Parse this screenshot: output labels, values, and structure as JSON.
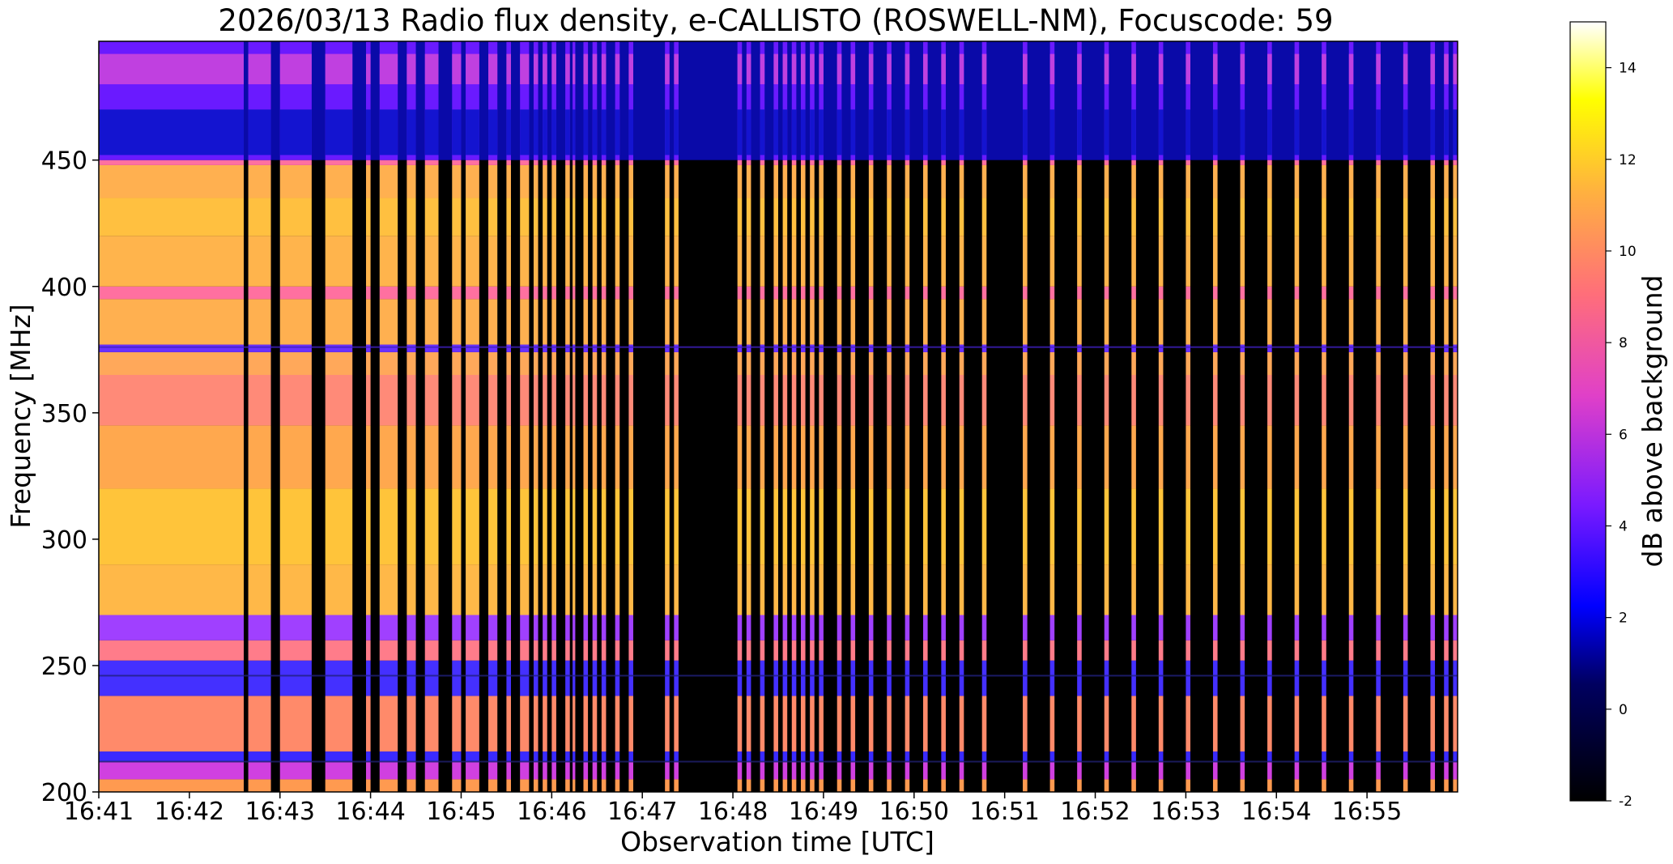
{
  "chart_data": {
    "type": "heatmap",
    "title": "2026/03/13  Radio flux density, e-CALLISTO (ROSWELL-NM), Focuscode: 59",
    "xlabel": "Observation time [UTC]",
    "ylabel": "Frequency [MHz]",
    "colorbar_label": "dB above background",
    "colormap": "gnuplot2",
    "x_ticks": [
      "16:41",
      "16:42",
      "16:43",
      "16:44",
      "16:45",
      "16:46",
      "16:47",
      "16:48",
      "16:49",
      "16:50",
      "16:51",
      "16:52",
      "16:53",
      "16:54",
      "16:55"
    ],
    "xlim": [
      "16:41:00",
      "16:56:00"
    ],
    "y_ticks": [
      200,
      250,
      300,
      350,
      400,
      450
    ],
    "ylim": [
      200,
      497
    ],
    "colorbar_ticks": [
      -2,
      0,
      2,
      4,
      6,
      8,
      10,
      12,
      14
    ],
    "clim": [
      -2,
      15
    ],
    "band_split_mhz": 450,
    "active_intervals_min": [
      [
        0.0,
        1.6
      ],
      [
        1.65,
        1.9
      ],
      [
        2.0,
        2.35
      ],
      [
        2.5,
        2.8
      ],
      [
        2.95,
        3.0
      ],
      [
        3.1,
        3.3
      ],
      [
        3.4,
        3.5
      ],
      [
        3.6,
        3.75
      ],
      [
        3.9,
        4.0
      ],
      [
        4.05,
        4.2
      ],
      [
        4.3,
        4.4
      ],
      [
        4.5,
        4.55
      ],
      [
        4.65,
        4.75
      ],
      [
        4.8,
        4.85
      ],
      [
        4.9,
        4.95
      ],
      [
        5.0,
        5.05
      ],
      [
        5.15,
        5.2
      ],
      [
        5.23,
        5.26
      ],
      [
        5.35,
        5.4
      ],
      [
        5.45,
        5.5
      ],
      [
        5.55,
        5.6
      ],
      [
        5.7,
        5.75
      ],
      [
        5.85,
        5.9
      ],
      [
        6.25,
        6.3
      ],
      [
        6.35,
        6.4
      ],
      [
        7.05,
        7.1
      ],
      [
        7.15,
        7.2
      ],
      [
        7.3,
        7.35
      ],
      [
        7.45,
        7.5
      ],
      [
        7.55,
        7.6
      ],
      [
        7.65,
        7.7
      ],
      [
        7.75,
        7.8
      ],
      [
        7.85,
        7.9
      ],
      [
        7.95,
        8.0
      ],
      [
        8.15,
        8.2
      ],
      [
        8.3,
        8.35
      ],
      [
        8.5,
        8.55
      ],
      [
        8.7,
        8.75
      ],
      [
        8.9,
        8.95
      ],
      [
        9.1,
        9.15
      ],
      [
        9.3,
        9.35
      ],
      [
        9.5,
        9.55
      ],
      [
        9.75,
        9.8
      ],
      [
        10.2,
        10.25
      ],
      [
        10.5,
        10.55
      ],
      [
        10.8,
        10.85
      ],
      [
        11.1,
        11.15
      ],
      [
        11.4,
        11.45
      ],
      [
        11.7,
        11.75
      ],
      [
        12.0,
        12.05
      ],
      [
        12.3,
        12.35
      ],
      [
        12.6,
        12.65
      ],
      [
        12.9,
        12.95
      ],
      [
        13.2,
        13.25
      ],
      [
        13.5,
        13.55
      ],
      [
        13.8,
        13.85
      ],
      [
        14.1,
        14.15
      ],
      [
        14.4,
        14.45
      ],
      [
        14.7,
        14.75
      ],
      [
        14.85,
        14.9
      ],
      [
        14.95,
        15.0
      ]
    ]
  }
}
